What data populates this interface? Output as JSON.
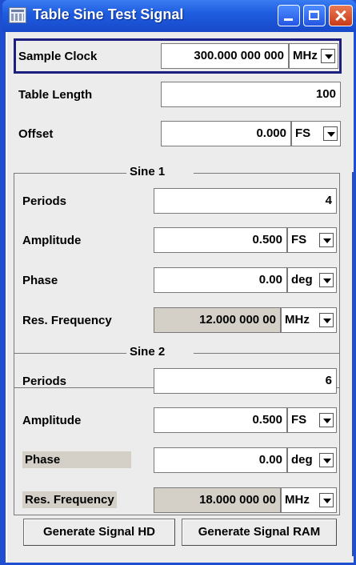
{
  "window": {
    "title": "Table Sine Test Signal"
  },
  "sample_clock": {
    "label": "Sample Clock",
    "value": "300.000 000 000",
    "unit": "MHz"
  },
  "table_length": {
    "label": "Table Length",
    "value": "100"
  },
  "offset": {
    "label": "Offset",
    "value": "0.000",
    "unit": "FS"
  },
  "sine1": {
    "title": "Sine 1",
    "periods": {
      "label": "Periods",
      "value": "4"
    },
    "amplitude": {
      "label": "Amplitude",
      "value": "0.500",
      "unit": "FS"
    },
    "phase": {
      "label": "Phase",
      "value": "0.00",
      "unit": "deg"
    },
    "res_frequency": {
      "label": "Res. Frequency",
      "value": "12.000 000 00",
      "unit": "MHz"
    }
  },
  "sine2": {
    "title": "Sine 2",
    "periods": {
      "label": "Periods",
      "value": "6"
    },
    "amplitude": {
      "label": "Amplitude",
      "value": "0.500",
      "unit": "FS"
    },
    "phase": {
      "label": "Phase",
      "value": "0.00",
      "unit": "deg"
    },
    "res_frequency": {
      "label": "Res. Frequency",
      "value": "18.000 000 00",
      "unit": "MHz"
    }
  },
  "buttons": {
    "generate_hd": "Generate Signal HD",
    "generate_ram": "Generate Signal RAM"
  },
  "colors": {
    "titlebar": "#1f5de0",
    "focus_border": "#1c1f80",
    "panel": "#ececec",
    "disabled_field": "#d4d0c8"
  }
}
